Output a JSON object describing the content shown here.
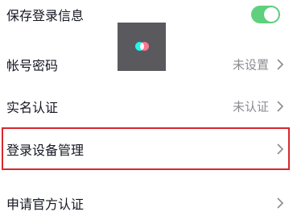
{
  "rows": [
    {
      "label": "保存登录信息",
      "toggle_on": true
    },
    {
      "label": "帐号密码",
      "value": "未设置"
    },
    {
      "label": "实名认证",
      "value": "未认证"
    },
    {
      "label": "登录设备管理",
      "highlighted": true
    },
    {
      "label": "申请官方认证"
    }
  ],
  "colors": {
    "toggle_on": "#5fd07d",
    "highlight_border": "#d8272d",
    "label_text": "#161823",
    "value_text": "#8a8b91"
  },
  "icons": {
    "chevron": "chevron-right-icon",
    "overlay": "app-logo-icon"
  }
}
